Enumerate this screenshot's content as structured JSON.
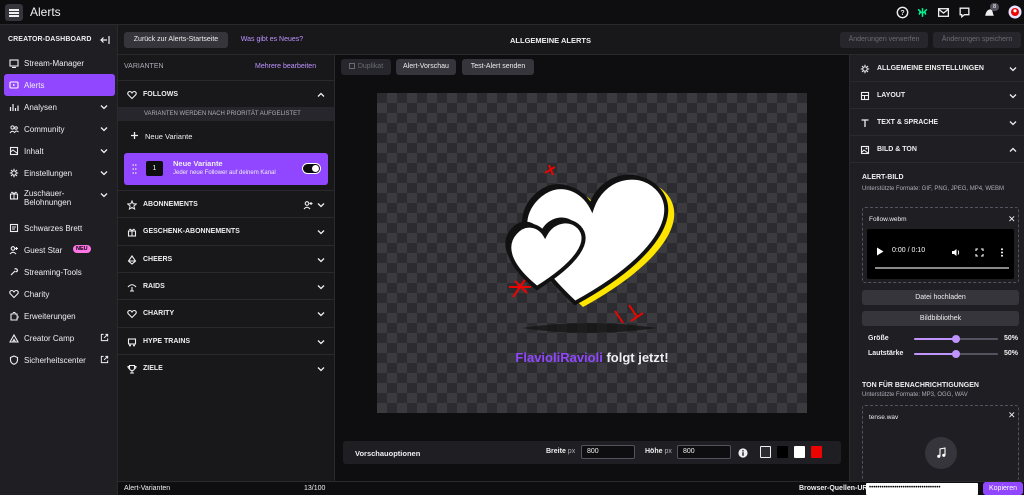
{
  "app": {
    "title": "Alerts"
  },
  "topbar": {
    "notification_count": "8"
  },
  "sidebar": {
    "header": "CREATOR-DASHBOARD",
    "items": [
      {
        "label": "Stream-Manager",
        "icon": "stream-manager-icon"
      },
      {
        "label": "Alerts",
        "icon": "alerts-icon",
        "active": true
      },
      {
        "label": "Analysen",
        "icon": "analytics-icon",
        "expandable": true
      },
      {
        "label": "Community",
        "icon": "community-icon",
        "expandable": true
      },
      {
        "label": "Inhalt",
        "icon": "content-icon",
        "expandable": true
      },
      {
        "label": "Einstellungen",
        "icon": "gear-icon",
        "expandable": true
      },
      {
        "label": "Zuschauer-\nBelohnungen",
        "icon": "gift-icon",
        "expandable": true
      },
      {
        "label": "Schwarzes Brett",
        "icon": "board-icon"
      },
      {
        "label": "Guest Star",
        "icon": "guest-star-icon",
        "badge": "NEU"
      },
      {
        "label": "Streaming-Tools",
        "icon": "tools-icon"
      },
      {
        "label": "Charity",
        "icon": "charity-icon"
      },
      {
        "label": "Erweiterungen",
        "icon": "extensions-icon"
      },
      {
        "label": "Creator Camp",
        "icon": "creator-camp-icon",
        "external": true
      },
      {
        "label": "Sicherheitscenter",
        "icon": "safety-icon",
        "external": true
      }
    ]
  },
  "actionrow": {
    "back": "Zurück zur Alerts-Startseite",
    "whatsnew": "Was gibt es Neues?",
    "title": "ALLGEMEINE ALERTS",
    "discard": "Änderungen verwerfen",
    "save": "Änderungen speichern"
  },
  "variants": {
    "header": "VARIANTEN",
    "edit_multiple": "Mehrere bearbeiten",
    "follows": "FOLLOWS",
    "priority_note": "VARIANTEN WERDEN NACH PRIORITÄT AUFGELISTET",
    "new_variant": "Neue Variante",
    "card": {
      "number": "1",
      "name": "Neue Variante",
      "desc": "Jeder neue Follower auf deinem Kanal",
      "enabled": true
    },
    "categories": [
      "ABONNEMENTS",
      "GESCHENK-ABONNEMENTS",
      "CHEERS",
      "RAIDS",
      "CHARITY",
      "HYPE TRAINS",
      "ZIELE"
    ]
  },
  "preview": {
    "duplicate": "Duplikat",
    "alert_preview": "Alert-Vorschau",
    "test_alert": "Test-Alert senden",
    "username": "FlavioliRavioli",
    "follow_suffix": " folgt jetzt!",
    "options_label": "Vorschauoptionen",
    "width_label": "Breite",
    "height_label": "Höhe",
    "unit": "px",
    "width_value": "800",
    "height_value": "800",
    "swatches": [
      "#2c2c30",
      "#000000",
      "#ffffff",
      "#eb0400"
    ]
  },
  "right": {
    "sections": [
      {
        "label": "ALLGEMEINE EINSTELLUNGEN",
        "icon": "gear-icon"
      },
      {
        "label": "LAYOUT",
        "icon": "layout-icon"
      },
      {
        "label": "TEXT & SPRACHE",
        "icon": "text-icon"
      },
      {
        "label": "BILD & TON",
        "icon": "image-icon",
        "expanded": true
      }
    ],
    "alert_image": "ALERT-BILD",
    "alert_image_formats": "Unterstützte Formate: GIF, PNG, JPEG, MP4, WEBM",
    "media_file": "Follow.webm",
    "player_time": "0:00 / 0:10",
    "upload": "Datei hochladen",
    "library": "Bildbibliothek",
    "size_label": "Größe",
    "size_value": "50%",
    "size_fraction": 0.5,
    "volume_label": "Lautstärke",
    "volume_value": "50%",
    "volume_fraction": 0.5,
    "sound_header": "TON FÜR BENACHRICHTIGUNGEN",
    "sound_formats": "Unterstützte Formate: MP3, OGG, WAV",
    "sound_file": "tense.wav"
  },
  "bottom": {
    "variants_label": "Alert-Varianten",
    "variants_count": "13/100",
    "source_label": "Browser-Quellen-URL",
    "source_value": "••••••••••••••••••••••••••••••••••",
    "copy": "Kopieren"
  },
  "colors": {
    "accent": "#9147ff",
    "accent_light": "#bf94ff",
    "bg": "#18181b"
  }
}
